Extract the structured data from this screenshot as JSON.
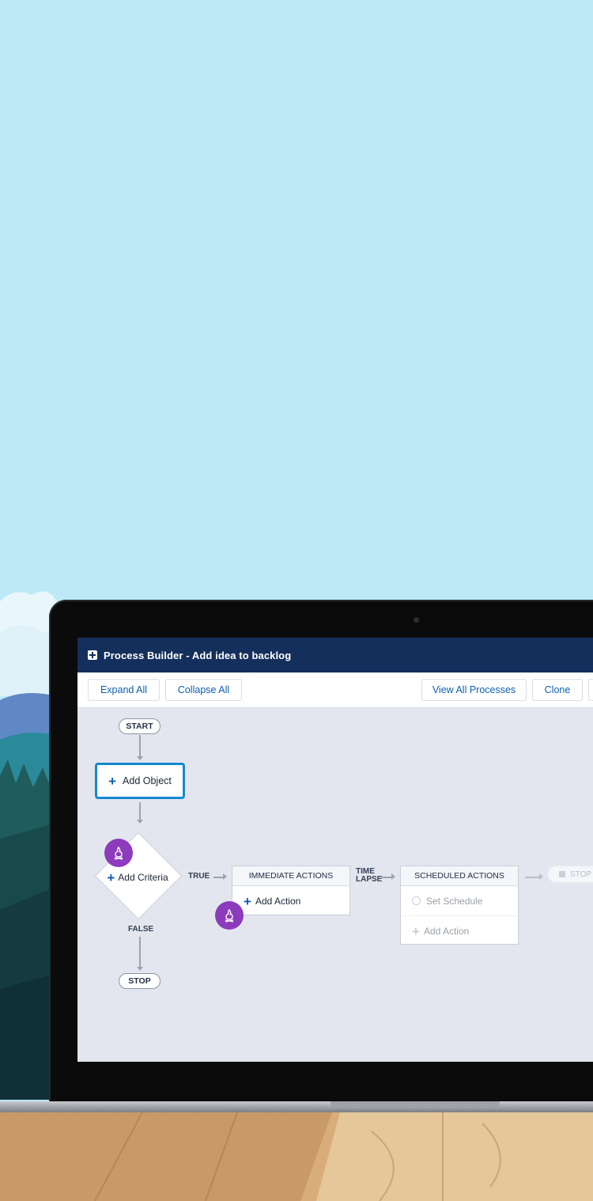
{
  "window": {
    "title": "Process Builder - Add idea to backlog"
  },
  "toolbar": {
    "expand_all": "Expand All",
    "collapse_all": "Collapse All",
    "view_all_processes": "View All Processes",
    "clone": "Clone"
  },
  "flow": {
    "start": "START",
    "add_object": "Add Object",
    "add_criteria": "Add Criteria",
    "true_label": "TRUE",
    "false_label": "FALSE",
    "stop": "STOP",
    "immediate_actions": {
      "header": "IMMEDIATE ACTIONS",
      "add_action": "Add Action"
    },
    "time_lapse_1": "TIME",
    "time_lapse_2": "LAPSE",
    "scheduled_actions": {
      "header": "SCHEDULED ACTIONS",
      "set_schedule": "Set Schedule",
      "add_action": "Add Action"
    },
    "stop_right": "STOP"
  },
  "colors": {
    "sky": "#bde9f7",
    "titlebar": "#142f5c",
    "accent_blue": "#1589d0",
    "badge_purple": "#8d3bbd"
  },
  "icons": [
    "plus-icon",
    "campfire-icon",
    "clock-icon",
    "stop-square-icon"
  ]
}
